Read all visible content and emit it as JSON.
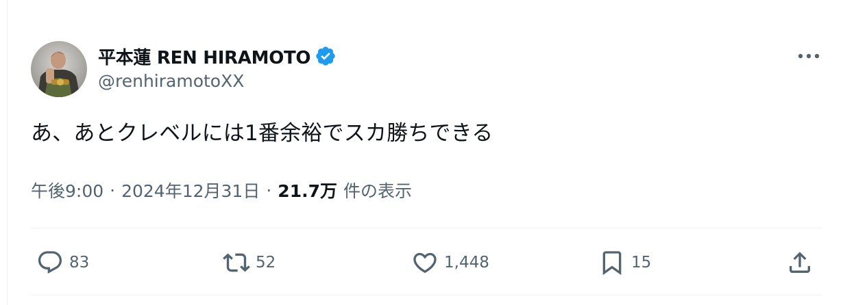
{
  "author": {
    "display_name": "平本蓮 REN HIRAMOTO",
    "handle": "@renhiramotoXX",
    "verified": true,
    "verified_color": "#1d9bf0"
  },
  "tweet": {
    "text": "あ、あとクレベルには1番余裕でスカ勝ちできる"
  },
  "meta": {
    "time": "午後9:00",
    "separator": "·",
    "date": "2024年12月31日",
    "views_count": "21.7万",
    "views_label": "件の表示"
  },
  "actions": {
    "replies": "83",
    "reposts": "52",
    "likes": "1,448",
    "bookmarks": "15"
  },
  "icons": {
    "reply": "reply-icon",
    "repost": "repost-icon",
    "like": "heart-icon",
    "bookmark": "bookmark-icon",
    "share": "share-icon",
    "more": "more-icon"
  },
  "colors": {
    "text_primary": "#0f1419",
    "text_secondary": "#536471",
    "divider": "#eff3f4"
  }
}
